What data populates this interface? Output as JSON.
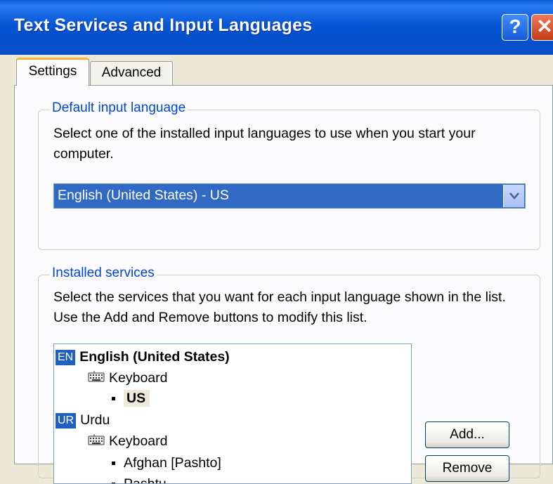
{
  "window": {
    "title": "Text Services and Input Languages",
    "help_glyph": "?",
    "close_glyph": "✕"
  },
  "tabs": [
    {
      "label": "Settings",
      "active": true
    },
    {
      "label": "Advanced",
      "active": false
    }
  ],
  "default_language": {
    "legend": "Default input language",
    "description": "Select one of the installed input languages to use when you start your computer.",
    "selected": "English (United States) - US"
  },
  "installed_services": {
    "legend": "Installed services",
    "description": "Select the services that you want for each input language shown in the list. Use the Add and Remove buttons to modify this list.",
    "tree": {
      "lang1": {
        "badge": "EN",
        "name": "English (United States)",
        "category": "Keyboard",
        "layouts": [
          "US"
        ]
      },
      "lang2": {
        "badge": "UR",
        "name": "Urdu",
        "category": "Keyboard",
        "layouts": [
          "Afghan [Pashto]",
          "Pashtu"
        ]
      }
    },
    "add_label": "Add...",
    "remove_label": "Remove"
  },
  "colors": {
    "titlebar": "#0655d6",
    "selection": "#316ac5",
    "group_legend": "#0046d5",
    "active_tab_accent": "#f7b532"
  }
}
